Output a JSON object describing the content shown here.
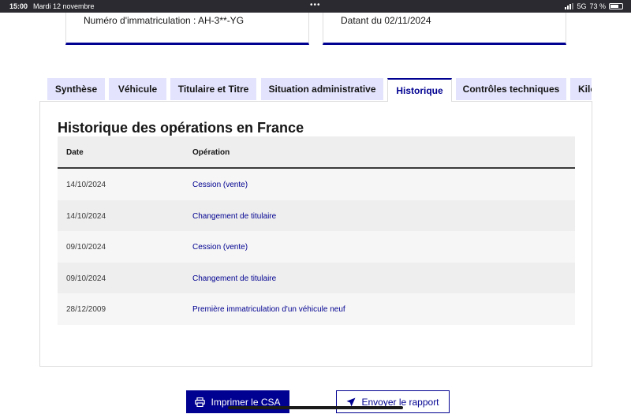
{
  "status_bar": {
    "time": "15:00",
    "date": "Mardi 12 novembre",
    "dots": "•••",
    "network": "5G",
    "battery": "73 %",
    "battery_level": 0.73
  },
  "cards": {
    "registration": "Numéro d'immatriculation : AH-3**-YG",
    "dated": "Datant du 02/11/2024"
  },
  "tabs": [
    {
      "label": "Synthèse",
      "active": false
    },
    {
      "label": "Véhicule",
      "active": false
    },
    {
      "label": "Titulaire et Titre",
      "active": false
    },
    {
      "label": "Situation administrative",
      "active": false
    },
    {
      "label": "Historique",
      "active": true
    },
    {
      "label": "Contrôles techniques",
      "active": false
    },
    {
      "label": "Kilo",
      "active": false
    }
  ],
  "history": {
    "title": "Historique des opérations en France",
    "columns": [
      "Date",
      "Opération"
    ],
    "rows": [
      {
        "date": "14/10/2024",
        "operation": "Cession (vente)"
      },
      {
        "date": "14/10/2024",
        "operation": "Changement de titulaire"
      },
      {
        "date": "09/10/2024",
        "operation": "Cession (vente)"
      },
      {
        "date": "09/10/2024",
        "operation": "Changement de titulaire"
      },
      {
        "date": "28/12/2009",
        "operation": "Première immatriculation d'un véhicule neuf"
      }
    ]
  },
  "actions": {
    "print_label": "Imprimer le CSA",
    "send_label": "Envoyer le rapport"
  },
  "colors": {
    "accent": "#000091",
    "tab_bg": "#e3e3fd",
    "status_bar": "#2a2a30"
  },
  "icons": {
    "print": "printer-icon",
    "send": "send-icon"
  }
}
